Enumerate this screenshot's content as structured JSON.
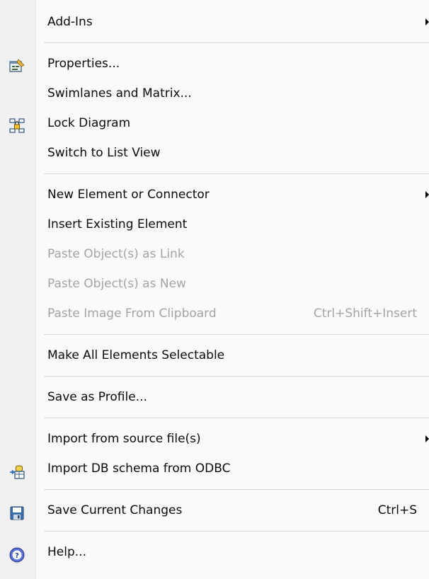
{
  "menu": {
    "groups": [
      {
        "items": [
          {
            "label": "Add-Ins",
            "submenu": true
          }
        ]
      },
      {
        "items": [
          {
            "label": "Properties...",
            "icon": "properties-icon"
          },
          {
            "label": "Swimlanes and Matrix..."
          },
          {
            "label": "Lock Diagram",
            "icon": "lock-diagram-icon"
          },
          {
            "label": "Switch to List View"
          }
        ]
      },
      {
        "items": [
          {
            "label": "New Element or Connector",
            "submenu": true
          },
          {
            "label": "Insert Existing Element"
          },
          {
            "label": "Paste Object(s) as Link",
            "disabled": true
          },
          {
            "label": "Paste Object(s) as New",
            "disabled": true
          },
          {
            "label": "Paste Image From Clipboard",
            "shortcut": "Ctrl+Shift+Insert",
            "disabled": true
          }
        ]
      },
      {
        "items": [
          {
            "label": "Make All Elements Selectable"
          }
        ]
      },
      {
        "items": [
          {
            "label": "Save as Profile..."
          }
        ]
      },
      {
        "items": [
          {
            "label": "Import from source file(s)",
            "submenu": true
          },
          {
            "label": "Import DB schema from ODBC",
            "icon": "import-db-schema-icon"
          }
        ]
      },
      {
        "items": [
          {
            "label": "Save Current Changes",
            "icon": "save-icon",
            "shortcut": "Ctrl+S"
          }
        ]
      },
      {
        "items": [
          {
            "label": "Help...",
            "icon": "help-icon"
          }
        ]
      }
    ]
  }
}
